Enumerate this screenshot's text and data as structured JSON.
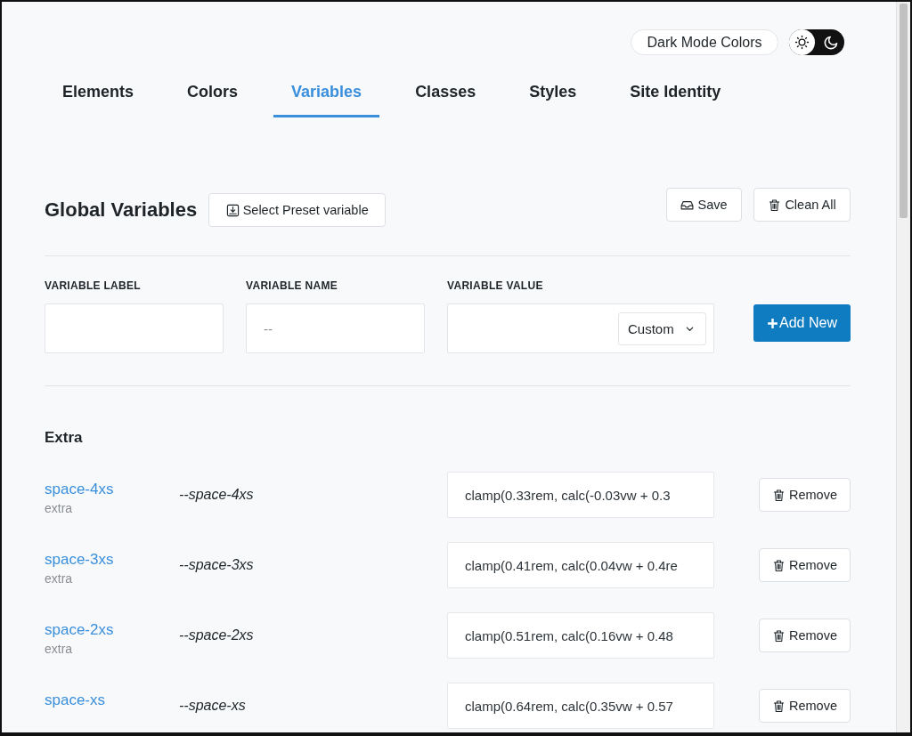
{
  "header": {
    "dark_mode_button": "Dark Mode Colors",
    "theme_toggle": {
      "on": false
    }
  },
  "tabs": [
    {
      "label": "Elements",
      "selected": false
    },
    {
      "label": "Colors",
      "selected": false
    },
    {
      "label": "Variables",
      "selected": true
    },
    {
      "label": "Classes",
      "selected": false
    },
    {
      "label": "Styles",
      "selected": false
    },
    {
      "label": "Site Identity",
      "selected": false
    }
  ],
  "section": {
    "title": "Global Variables",
    "preset_button": "Select Preset variable",
    "actions": [
      {
        "kind": "save",
        "label": "Save"
      },
      {
        "kind": "clean",
        "label": "Clean All"
      }
    ]
  },
  "form": {
    "fields": [
      {
        "kind": "text",
        "label": "VARIABLE LABEL"
      },
      {
        "kind": "text",
        "label": "VARIABLE NAME",
        "placeholder": "--"
      },
      {
        "kind": "value",
        "label": "VARIABLE VALUE",
        "select": "Custom"
      }
    ],
    "add_button": "Add New"
  },
  "groups": [
    {
      "title": "Extra",
      "variables": [
        {
          "label": "space-4xs",
          "group": "extra",
          "name": "--space-4xs",
          "value": "clamp(0.33rem, calc(-0.03vw + 0.3",
          "action": "Remove"
        },
        {
          "label": "space-3xs",
          "group": "extra",
          "name": "--space-3xs",
          "value": "clamp(0.41rem, calc(0.04vw + 0.4re",
          "action": "Remove"
        },
        {
          "label": "space-2xs",
          "group": "extra",
          "name": "--space-2xs",
          "value": "clamp(0.51rem, calc(0.16vw + 0.48",
          "action": "Remove"
        },
        {
          "label": "space-xs",
          "name": "--space-xs",
          "value": "clamp(0.64rem, calc(0.35vw + 0.57",
          "action": "Remove"
        }
      ]
    }
  ]
}
